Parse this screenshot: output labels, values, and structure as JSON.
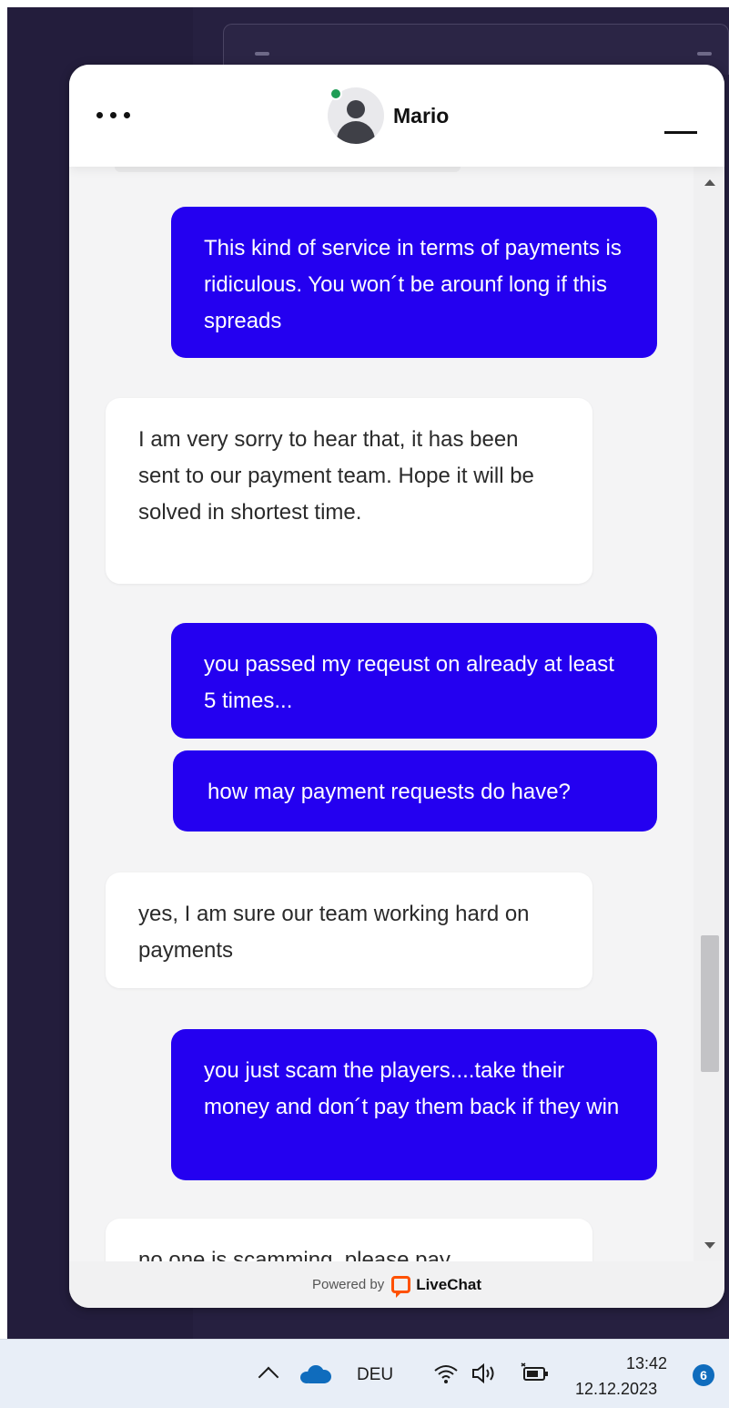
{
  "header": {
    "agent_name": "Mario",
    "menu_icon": "more-horizontal-icon",
    "minimize_icon": "minimize-icon",
    "status_color": "#1f9d55"
  },
  "messages": [
    {
      "sender": "visitor",
      "text": "This kind of service in terms of payments is ridiculous. You won´t be arounf long if this spreads"
    },
    {
      "sender": "agent",
      "text": "I am very sorry to hear that, it has been sent to our payment team. Hope it will be solved in shortest time."
    },
    {
      "sender": "visitor",
      "text": "you passed my reqeust on already at least 5 times..."
    },
    {
      "sender": "visitor",
      "text": "how may payment requests do have?"
    },
    {
      "sender": "agent",
      "text": "yes, I am sure our team working hard on payments"
    },
    {
      "sender": "visitor",
      "text": "you just scam the players....take their money and don´t pay them back if they win"
    },
    {
      "sender": "agent",
      "text": "no one is scamming, please pay"
    }
  ],
  "colors": {
    "visitor_bubble": "#2400f0",
    "agent_bubble": "#ffffff",
    "brand_accent": "#ff5100"
  },
  "footer": {
    "powered_by": "Powered by",
    "brand": "LiveChat",
    "brand_icon": "livechat-logo-icon"
  },
  "taskbar": {
    "language": "DEU",
    "time": "13:42",
    "date": "12.12.2023",
    "notification_count": "6",
    "icons": [
      "chevron-up-icon",
      "onedrive-cloud-icon",
      "wifi-icon",
      "speaker-icon",
      "battery-charging-icon"
    ]
  }
}
